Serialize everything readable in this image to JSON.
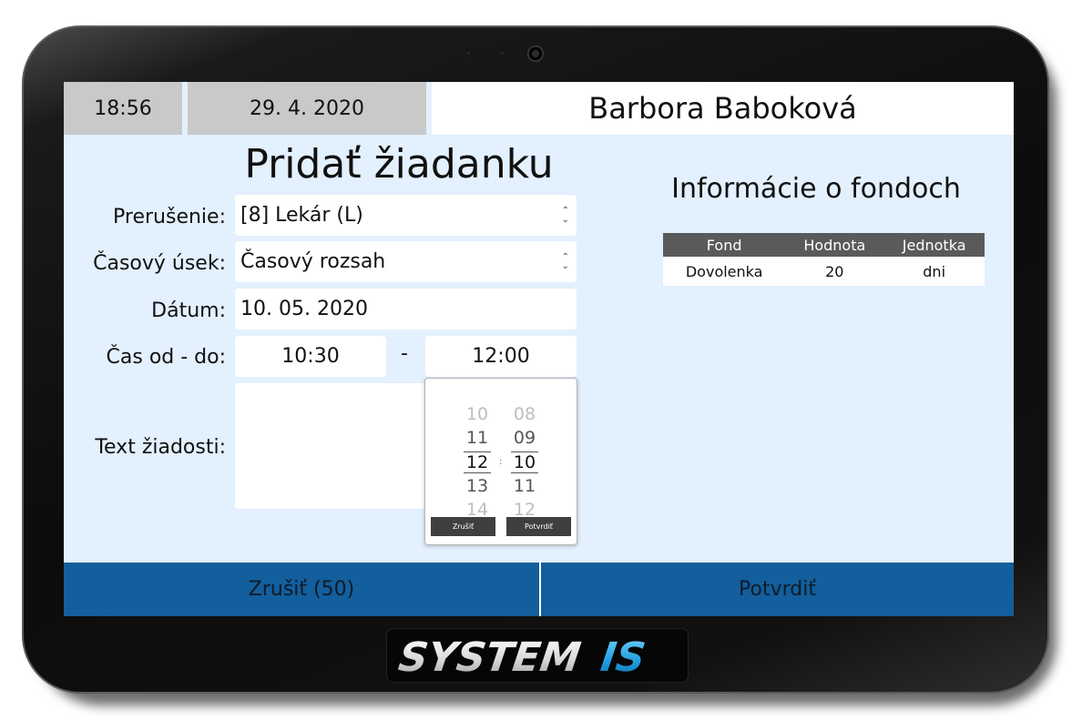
{
  "header": {
    "time": "18:56",
    "date": "29. 4. 2020",
    "user_name": "Barbora Baboková"
  },
  "form": {
    "title": "Pridať žiadanku",
    "labels": {
      "interruption": "Prerušenie:",
      "time_segment": "Časový úsek:",
      "date": "Dátum:",
      "time_range": "Čas od - do:",
      "request_text": "Text žiadosti:"
    },
    "interruption_value": "[8] Lekár (L)",
    "time_segment_value": "Časový rozsah",
    "date_value": "10. 05. 2020",
    "time_from": "10:30",
    "time_separator": "-",
    "time_to": "12:00",
    "request_text_value": ""
  },
  "time_picker": {
    "hours": [
      "10",
      "11",
      "12",
      "13",
      "14"
    ],
    "minutes": [
      "08",
      "09",
      "10",
      "11",
      "12"
    ],
    "selected_hour": "12",
    "selected_minute": "10",
    "colon": ":",
    "cancel_label": "Zrušiť",
    "confirm_label": "Potvrdiť"
  },
  "funds": {
    "title": "Informácie o fondoch",
    "columns": [
      "Fond",
      "Hodnota",
      "Jednotka"
    ],
    "rows": [
      {
        "fond": "Dovolenka",
        "hodnota": "20",
        "jednotka": "dni"
      }
    ]
  },
  "footer": {
    "cancel_label": "Zrušiť (50)",
    "confirm_label": "Potvrdiť"
  },
  "branding": {
    "logo_text": "SYSTEM-IS"
  },
  "colors": {
    "screen_bg": "#e3f0fd",
    "header_gray": "#c9c9c9",
    "footer_blue": "#135e9c",
    "table_header": "#5a5a5a",
    "logo_blue": "#1f9bdc"
  }
}
